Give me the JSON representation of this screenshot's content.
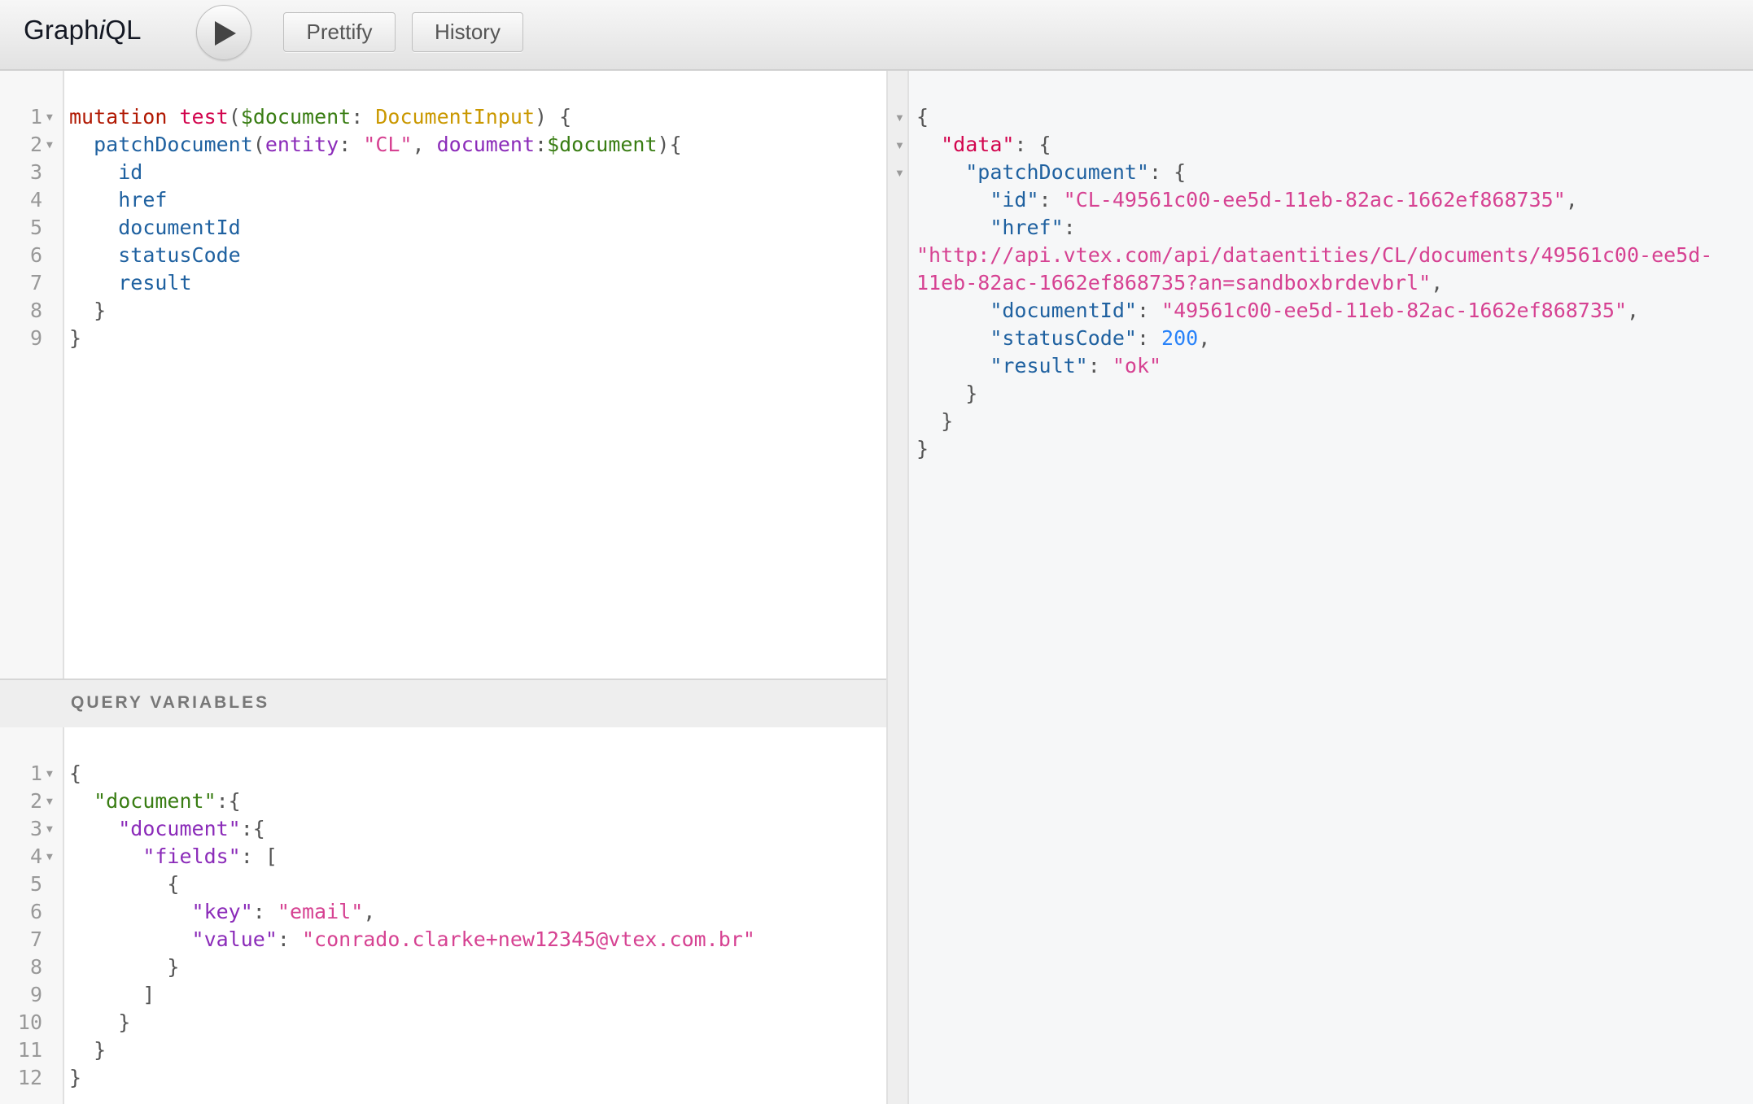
{
  "app": {
    "title_prefix": "Graph",
    "title_italic": "i",
    "title_suffix": "QL"
  },
  "toolbar": {
    "execute_icon": "play-icon",
    "prettify_label": "Prettify",
    "history_label": "History"
  },
  "query_editor": {
    "fold_icon": "triangle-down-icon",
    "lines": [
      {
        "n": "1",
        "fold": true,
        "tokens": [
          {
            "t": "mutation",
            "c": "kw"
          },
          {
            "t": " ",
            "c": "punct"
          },
          {
            "t": "test",
            "c": "def"
          },
          {
            "t": "(",
            "c": "punct"
          },
          {
            "t": "$document",
            "c": "var"
          },
          {
            "t": ": ",
            "c": "punct"
          },
          {
            "t": "DocumentInput",
            "c": "type"
          },
          {
            "t": ") {",
            "c": "punct"
          }
        ]
      },
      {
        "n": "2",
        "fold": true,
        "tokens": [
          {
            "t": "  ",
            "c": "punct"
          },
          {
            "t": "patchDocument",
            "c": "prop"
          },
          {
            "t": "(",
            "c": "punct"
          },
          {
            "t": "entity",
            "c": "attr"
          },
          {
            "t": ": ",
            "c": "punct"
          },
          {
            "t": "\"CL\"",
            "c": "str"
          },
          {
            "t": ", ",
            "c": "punct"
          },
          {
            "t": "document",
            "c": "attr"
          },
          {
            "t": ":",
            "c": "punct"
          },
          {
            "t": "$document",
            "c": "var"
          },
          {
            "t": "){",
            "c": "punct"
          }
        ]
      },
      {
        "n": "3",
        "fold": false,
        "tokens": [
          {
            "t": "    ",
            "c": "punct"
          },
          {
            "t": "id",
            "c": "prop"
          }
        ]
      },
      {
        "n": "4",
        "fold": false,
        "tokens": [
          {
            "t": "    ",
            "c": "punct"
          },
          {
            "t": "href",
            "c": "prop"
          }
        ]
      },
      {
        "n": "5",
        "fold": false,
        "tokens": [
          {
            "t": "    ",
            "c": "punct"
          },
          {
            "t": "documentId",
            "c": "prop"
          }
        ]
      },
      {
        "n": "6",
        "fold": false,
        "tokens": [
          {
            "t": "    ",
            "c": "punct"
          },
          {
            "t": "statusCode",
            "c": "prop"
          }
        ]
      },
      {
        "n": "7",
        "fold": false,
        "tokens": [
          {
            "t": "    ",
            "c": "punct"
          },
          {
            "t": "result",
            "c": "prop"
          }
        ]
      },
      {
        "n": "8",
        "fold": false,
        "tokens": [
          {
            "t": "  }",
            "c": "punct"
          }
        ]
      },
      {
        "n": "9",
        "fold": false,
        "tokens": [
          {
            "t": "}",
            "c": "punct"
          }
        ]
      }
    ]
  },
  "variables_panel": {
    "title": "QUERY VARIABLES",
    "lines": [
      {
        "n": "1",
        "fold": true,
        "tokens": [
          {
            "t": "{",
            "c": "punct"
          }
        ]
      },
      {
        "n": "2",
        "fold": true,
        "tokens": [
          {
            "t": "  ",
            "c": "punct"
          },
          {
            "t": "\"document\"",
            "c": "jkey-green"
          },
          {
            "t": ":{",
            "c": "punct"
          }
        ]
      },
      {
        "n": "3",
        "fold": true,
        "tokens": [
          {
            "t": "    ",
            "c": "punct"
          },
          {
            "t": "\"document\"",
            "c": "jkey-purple"
          },
          {
            "t": ":{",
            "c": "punct"
          }
        ]
      },
      {
        "n": "4",
        "fold": true,
        "tokens": [
          {
            "t": "      ",
            "c": "punct"
          },
          {
            "t": "\"fields\"",
            "c": "jkey-purple"
          },
          {
            "t": ": [",
            "c": "punct"
          }
        ]
      },
      {
        "n": "5",
        "fold": false,
        "tokens": [
          {
            "t": "        {",
            "c": "punct"
          }
        ]
      },
      {
        "n": "6",
        "fold": false,
        "tokens": [
          {
            "t": "          ",
            "c": "punct"
          },
          {
            "t": "\"key\"",
            "c": "jkey-purple"
          },
          {
            "t": ": ",
            "c": "punct"
          },
          {
            "t": "\"email\"",
            "c": "str"
          },
          {
            "t": ",",
            "c": "punct"
          }
        ]
      },
      {
        "n": "7",
        "fold": false,
        "tokens": [
          {
            "t": "          ",
            "c": "punct"
          },
          {
            "t": "\"value\"",
            "c": "jkey-purple"
          },
          {
            "t": ": ",
            "c": "punct"
          },
          {
            "t": "\"conrado.clarke+new12345@vtex.com.br\"",
            "c": "str"
          }
        ]
      },
      {
        "n": "8",
        "fold": false,
        "tokens": [
          {
            "t": "        }",
            "c": "punct"
          }
        ]
      },
      {
        "n": "9",
        "fold": false,
        "tokens": [
          {
            "t": "      ]",
            "c": "punct"
          }
        ]
      },
      {
        "n": "10",
        "fold": false,
        "tokens": [
          {
            "t": "    }",
            "c": "punct"
          }
        ]
      },
      {
        "n": "11",
        "fold": false,
        "tokens": [
          {
            "t": "  }",
            "c": "punct"
          }
        ]
      },
      {
        "n": "12",
        "fold": false,
        "tokens": [
          {
            "t": "}",
            "c": "punct"
          }
        ]
      }
    ]
  },
  "result_viewer": {
    "fold_icon": "triangle-down-icon",
    "lines": [
      {
        "fold": true,
        "tokens": [
          {
            "t": "{",
            "c": "punct"
          }
        ]
      },
      {
        "fold": true,
        "tokens": [
          {
            "t": "  ",
            "c": "punct"
          },
          {
            "t": "\"data\"",
            "c": "jkey-red"
          },
          {
            "t": ": {",
            "c": "punct"
          }
        ]
      },
      {
        "fold": true,
        "tokens": [
          {
            "t": "    ",
            "c": "punct"
          },
          {
            "t": "\"patchDocument\"",
            "c": "jkey-blue"
          },
          {
            "t": ": {",
            "c": "punct"
          }
        ]
      },
      {
        "fold": false,
        "tokens": [
          {
            "t": "      ",
            "c": "punct"
          },
          {
            "t": "\"id\"",
            "c": "jkey-blue"
          },
          {
            "t": ": ",
            "c": "punct"
          },
          {
            "t": "\"CL-49561c00-ee5d-11eb-82ac-1662ef868735\"",
            "c": "str"
          },
          {
            "t": ",",
            "c": "punct"
          }
        ]
      },
      {
        "fold": false,
        "tokens": [
          {
            "t": "      ",
            "c": "punct"
          },
          {
            "t": "\"href\"",
            "c": "jkey-blue"
          },
          {
            "t": ":",
            "c": "punct"
          }
        ]
      },
      {
        "fold": false,
        "tokens": [
          {
            "t": "\"http://api.vtex.com/api/dataentities/CL/documents/49561c00-ee5d-",
            "c": "str"
          }
        ]
      },
      {
        "fold": false,
        "tokens": [
          {
            "t": "11eb-82ac-1662ef868735?an=sandboxbrdevbrl\"",
            "c": "str"
          },
          {
            "t": ",",
            "c": "punct"
          }
        ]
      },
      {
        "fold": false,
        "tokens": [
          {
            "t": "      ",
            "c": "punct"
          },
          {
            "t": "\"documentId\"",
            "c": "jkey-blue"
          },
          {
            "t": ": ",
            "c": "punct"
          },
          {
            "t": "\"49561c00-ee5d-11eb-82ac-1662ef868735\"",
            "c": "str"
          },
          {
            "t": ",",
            "c": "punct"
          }
        ]
      },
      {
        "fold": false,
        "tokens": [
          {
            "t": "      ",
            "c": "punct"
          },
          {
            "t": "\"statusCode\"",
            "c": "jkey-blue"
          },
          {
            "t": ": ",
            "c": "punct"
          },
          {
            "t": "200",
            "c": "num"
          },
          {
            "t": ",",
            "c": "punct"
          }
        ]
      },
      {
        "fold": false,
        "tokens": [
          {
            "t": "      ",
            "c": "punct"
          },
          {
            "t": "\"result\"",
            "c": "jkey-blue"
          },
          {
            "t": ": ",
            "c": "punct"
          },
          {
            "t": "\"ok\"",
            "c": "str"
          }
        ]
      },
      {
        "fold": false,
        "tokens": [
          {
            "t": "    }",
            "c": "punct"
          }
        ]
      },
      {
        "fold": false,
        "tokens": [
          {
            "t": "  }",
            "c": "punct"
          }
        ]
      },
      {
        "fold": false,
        "tokens": [
          {
            "t": "}",
            "c": "punct"
          }
        ]
      }
    ]
  }
}
